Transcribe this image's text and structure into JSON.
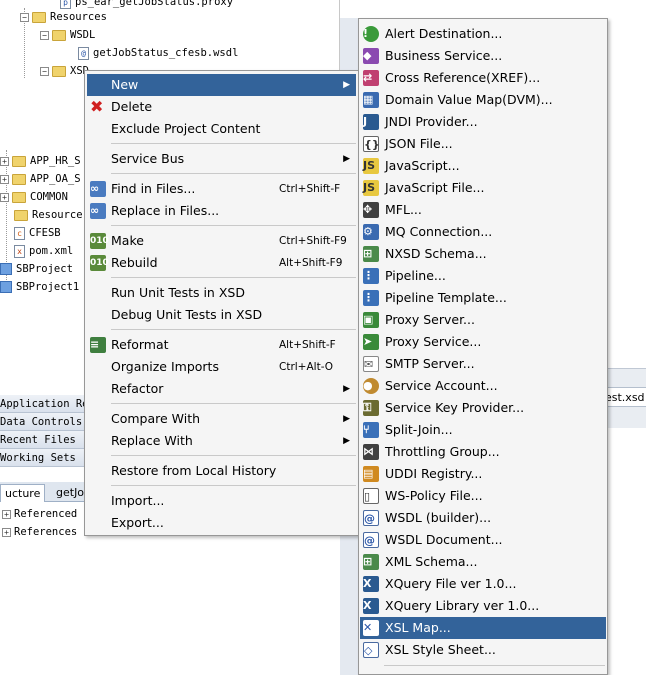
{
  "tree": {
    "top_item": "ps_ear_getJobStatus.proxy",
    "resources": "Resources",
    "wsdl_folder": "WSDL",
    "wsdl_file": "getJobStatus_cfesb.wsdl",
    "xsd_folder": "XSD",
    "app_hr": "APP_HR_S",
    "app_oa": "APP_OA_S",
    "common": "COMMON",
    "resources2": "Resource",
    "cfesb": "CFESB",
    "pom": "pom.xml",
    "sbproject": "SBProject",
    "sbproject1": "SBProject1"
  },
  "panels": {
    "application_resources": "Application Res",
    "data_controls": "Data Controls",
    "recent_files": "Recent Files",
    "working_sets": "Working Sets"
  },
  "structure": {
    "tab_structure": "ucture",
    "tab_getjob": "getJob",
    "item_referenced": "Referenced",
    "item_references": "References"
  },
  "editor": {
    "tab_label": "est.xsd -"
  },
  "context_menu": {
    "new": "New",
    "delete": "Delete",
    "exclude": "Exclude Project Content",
    "service_bus": "Service Bus",
    "find_in_files": "Find in Files...",
    "find_in_files_sc": "Ctrl+Shift-F",
    "replace_in_files": "Replace in Files...",
    "make": "Make",
    "make_sc": "Ctrl+Shift-F9",
    "rebuild": "Rebuild",
    "rebuild_sc": "Alt+Shift-F9",
    "run_unit_tests": "Run Unit Tests in XSD",
    "debug_unit_tests": "Debug Unit Tests in XSD",
    "reformat": "Reformat",
    "reformat_sc": "Alt+Shift-F",
    "organize_imports": "Organize Imports",
    "organize_imports_sc": "Ctrl+Alt-O",
    "refactor": "Refactor",
    "compare_with": "Compare With",
    "replace_with": "Replace With",
    "restore_history": "Restore from Local History",
    "import": "Import...",
    "export": "Export..."
  },
  "submenu": {
    "items": [
      "Alert Destination...",
      "Business Service...",
      "Cross Reference(XREF)...",
      "Domain Value Map(DVM)...",
      "JNDI Provider...",
      "JSON File...",
      "JavaScript...",
      "JavaScript File...",
      "MFL...",
      "MQ Connection...",
      "NXSD Schema...",
      "Pipeline...",
      "Pipeline Template...",
      "Proxy Server...",
      "Proxy Service...",
      "SMTP Server...",
      "Service Account...",
      "Service Key Provider...",
      "Split-Join...",
      "Throttling Group...",
      "UDDI Registry...",
      "WS-Policy File...",
      "WSDL (builder)...",
      "WSDL Document...",
      "XML Schema...",
      "XQuery File ver 1.0...",
      "XQuery Library ver 1.0...",
      "XSL Map...",
      "XSL Style Sheet..."
    ],
    "highlighted": "XSL Map..."
  },
  "colors": {
    "highlight": "#33639a",
    "menu_bg": "#f5f5f5"
  }
}
